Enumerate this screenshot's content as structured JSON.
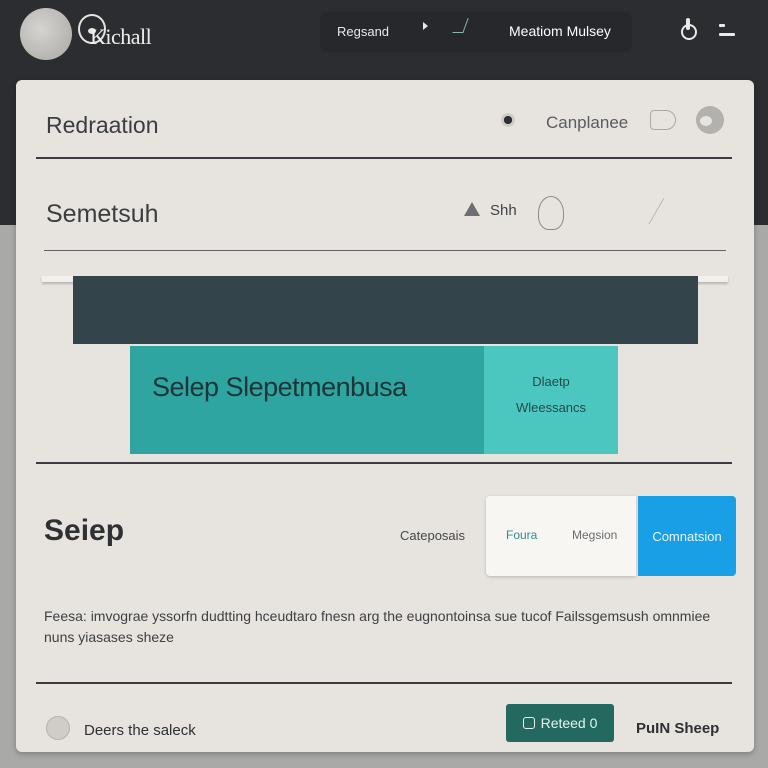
{
  "header": {
    "brand": "Kichall",
    "nav": [
      "Regsand",
      "Meatiom Mulsey"
    ]
  },
  "card": {
    "section1": {
      "title": "Redraation",
      "aside": "Canplanee"
    },
    "section2": {
      "title": "Semetsuh",
      "aside": "Shh"
    },
    "banner": {
      "title": "Selep Slepetmenbusa",
      "side_lines": [
        "Dlaetp",
        "Wleessancs"
      ]
    },
    "sleep": {
      "title": "Seiep",
      "categories_label": "Cateposais",
      "options": [
        "Foura",
        "Megsion"
      ],
      "primary_button": "Comnatsion"
    },
    "description": "Feesa: imvograe yssorfn dudtting hceudtaro fnesn arg the eugnontoinsa sue tucof Failssgemsush omnmiee nuns yiasases sheze",
    "footer": {
      "label": "Deers the saleck",
      "report_button": "Reteed 0",
      "plan_link": "PuIN Sheep"
    }
  },
  "colors": {
    "topbar": "#2b2d30",
    "card": "#e7e4df",
    "teal": "#2fa5a1",
    "teal_light": "#4cc7bf",
    "blue": "#189fe5",
    "green_button": "#24695f"
  }
}
